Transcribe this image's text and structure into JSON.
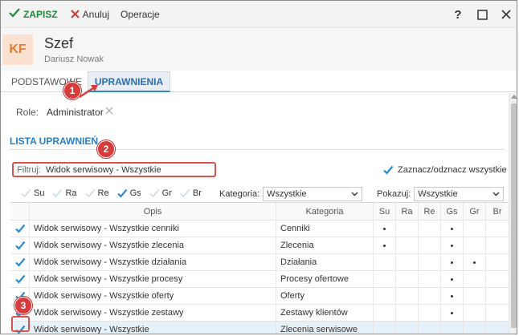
{
  "toolbar": {
    "save_label": "ZAPISZ",
    "cancel_label": "Anuluj",
    "operations_label": "Operacje",
    "help_label": "?"
  },
  "header": {
    "avatar_initials": "KF",
    "title": "Szef",
    "subtitle": "Dariusz Nowak"
  },
  "tabs": {
    "basic": "PODSTAWOWE",
    "permissions": "UPRAWNIENIA"
  },
  "role": {
    "label": "Role:",
    "value": "Administrator"
  },
  "section_title": "LISTA UPRAWNIEŃ",
  "filter": {
    "label": "Filtruj:",
    "value": "Widok serwisowy - Wszystkie"
  },
  "select_all_label": "Zaznacz/odznacz wszystkie",
  "flags": [
    {
      "label": "Su",
      "checked": false
    },
    {
      "label": "Ra",
      "checked": false
    },
    {
      "label": "Re",
      "checked": false
    },
    {
      "label": "Gs",
      "checked": true
    },
    {
      "label": "Gr",
      "checked": false
    },
    {
      "label": "Br",
      "checked": false
    }
  ],
  "category_filter": {
    "label": "Kategoria:",
    "value": "Wszystkie"
  },
  "show_filter": {
    "label": "Pokazuj:",
    "value": "Wszystkie"
  },
  "table": {
    "headers": [
      "Opis",
      "Kategoria",
      "Su",
      "Ra",
      "Re",
      "Gs",
      "Gr",
      "Br"
    ],
    "rows": [
      {
        "desc": "Widok serwisowy - Wszystkie cenniki",
        "cat": "Cenniki",
        "flags": [
          true,
          false,
          false,
          true,
          false,
          false
        ]
      },
      {
        "desc": "Widok serwisowy - Wszystkie zlecenia",
        "cat": "Zlecenia",
        "flags": [
          true,
          false,
          false,
          true,
          false,
          false
        ]
      },
      {
        "desc": "Widok serwisowy - Wszystkie działania",
        "cat": "Działania",
        "flags": [
          false,
          false,
          false,
          true,
          true,
          false
        ]
      },
      {
        "desc": "Widok serwisowy - Wszystkie procesy",
        "cat": "Procesy ofertowe",
        "flags": [
          false,
          false,
          false,
          true,
          false,
          false
        ]
      },
      {
        "desc": "Widok serwisowy - Wszystkie oferty",
        "cat": "Oferty",
        "flags": [
          false,
          false,
          false,
          true,
          false,
          false
        ]
      },
      {
        "desc": "Widok serwisowy - Wszystkie zestawy",
        "cat": "Zestawy klientów",
        "flags": [
          false,
          false,
          false,
          true,
          false,
          false
        ]
      },
      {
        "desc": "Widok serwisowy - Wszystkie",
        "cat": "Zlecenia serwisowe",
        "flags": [
          false,
          false,
          false,
          false,
          false,
          false
        ]
      }
    ]
  },
  "annotations": [
    "1",
    "2",
    "3"
  ],
  "colors": {
    "accent": "#2a7fc4",
    "save": "#1e8a3a",
    "cancel": "#d83b3b",
    "annotation": "#d83b3b",
    "avatar_bg": "#fbe2d0",
    "avatar_fg": "#e07c35"
  }
}
